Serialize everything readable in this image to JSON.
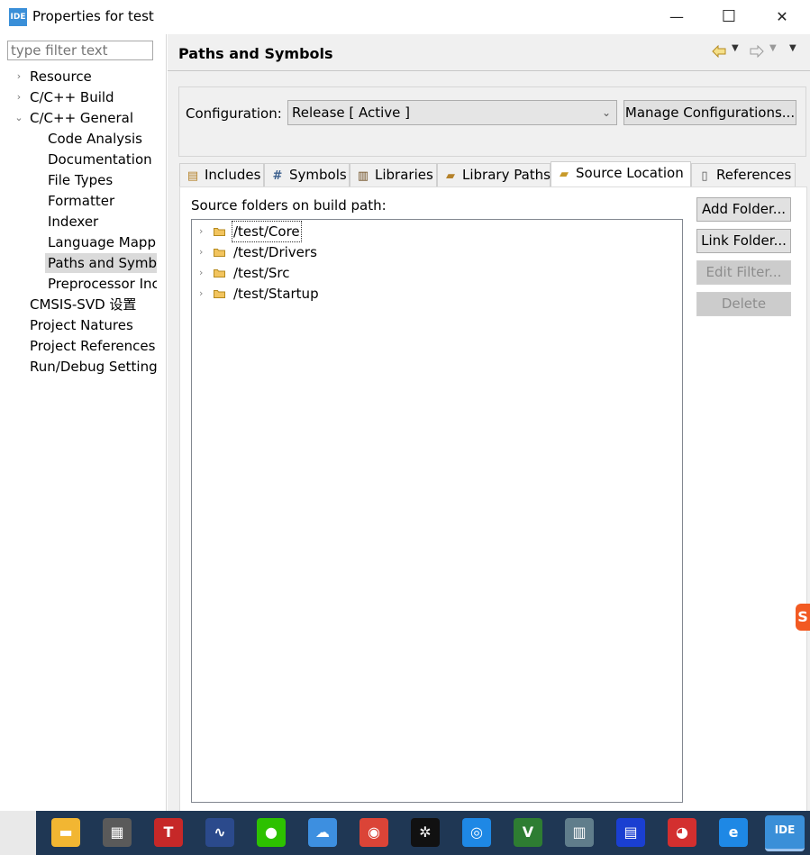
{
  "window": {
    "title": "Properties for test",
    "app_icon": "IDE",
    "minimize_glyph": "—",
    "maximize_glyph": "☐",
    "close_glyph": "✕"
  },
  "sidebar": {
    "filter_placeholder": "type filter text",
    "items": [
      {
        "label": "Resource",
        "level": 0,
        "expander": "collapsed"
      },
      {
        "label": "C/C++ Build",
        "level": 0,
        "expander": "collapsed"
      },
      {
        "label": "C/C++ General",
        "level": 0,
        "expander": "expanded"
      },
      {
        "label": "Code Analysis",
        "level": 1,
        "expander": "collapsed"
      },
      {
        "label": "Documentation",
        "level": 1,
        "expander": "none"
      },
      {
        "label": "File Types",
        "level": 1,
        "expander": "none"
      },
      {
        "label": "Formatter",
        "level": 1,
        "expander": "none"
      },
      {
        "label": "Indexer",
        "level": 1,
        "expander": "none"
      },
      {
        "label": "Language Mappi",
        "level": 1,
        "expander": "none"
      },
      {
        "label": "Paths and Symbo",
        "level": 1,
        "expander": "none",
        "selected": true
      },
      {
        "label": "Preprocessor Inc",
        "level": 1,
        "expander": "none"
      },
      {
        "label": "CMSIS-SVD 设置",
        "level": 0,
        "expander": "none"
      },
      {
        "label": "Project Natures",
        "level": 0,
        "expander": "none"
      },
      {
        "label": "Project References",
        "level": 0,
        "expander": "none"
      },
      {
        "label": "Run/Debug Setting",
        "level": 0,
        "expander": "none"
      }
    ]
  },
  "header": {
    "title": "Paths and Symbols",
    "back_icon": "back-arrow-icon",
    "forward_icon": "forward-arrow-icon"
  },
  "configuration": {
    "label": "Configuration:",
    "selected": "Release  [ Active ]",
    "manage_button": "Manage Configurations..."
  },
  "tabs": [
    {
      "label": "Includes",
      "icon": "includes-icon",
      "active": false
    },
    {
      "label": "Symbols",
      "icon": "hash-icon",
      "active": false
    },
    {
      "label": "Libraries",
      "icon": "libraries-icon",
      "active": false
    },
    {
      "label": "Library Paths",
      "icon": "library-paths-icon",
      "active": false
    },
    {
      "label": "Source Location",
      "icon": "folder-open-icon",
      "active": true
    },
    {
      "label": "References",
      "icon": "references-icon",
      "active": false
    }
  ],
  "source_location": {
    "label": "Source folders on build path:",
    "folders": [
      "/test/Core",
      "/test/Drivers",
      "/test/Src",
      "/test/Startup"
    ],
    "buttons": {
      "add_folder": "Add Folder...",
      "link_folder": "Link Folder...",
      "edit_filter": "Edit Filter...",
      "delete": "Delete"
    }
  },
  "taskbar": {
    "apps": [
      {
        "name": "file-explorer",
        "glyph": "▬",
        "color": "#f2b632"
      },
      {
        "name": "calculator",
        "glyph": "▦",
        "color": "#5a5a5a"
      },
      {
        "name": "tiktok-toolbox",
        "glyph": "T",
        "color": "#c62828"
      },
      {
        "name": "graph-app",
        "glyph": "∿",
        "color": "#2b4a8c"
      },
      {
        "name": "wechat",
        "glyph": "●",
        "color": "#2dc100"
      },
      {
        "name": "cloud-drive",
        "glyph": "☁",
        "color": "#3d8fe0"
      },
      {
        "name": "chrome",
        "glyph": "◉",
        "color": "#db4437"
      },
      {
        "name": "atom-app",
        "glyph": "✲",
        "color": "#111111"
      },
      {
        "name": "spiral-app",
        "glyph": "◎",
        "color": "#1e88e5"
      },
      {
        "name": "keil-v5",
        "glyph": "V",
        "color": "#2e7d32"
      },
      {
        "name": "building-app",
        "glyph": "▥",
        "color": "#607d8b"
      },
      {
        "name": "grid-building-app",
        "glyph": "▤",
        "color": "#1a3fd1"
      },
      {
        "name": "pig-app",
        "glyph": "◕",
        "color": "#d32f2f"
      },
      {
        "name": "edge-browser",
        "glyph": "e",
        "color": "#1e88e5"
      },
      {
        "name": "stm32cubeide",
        "glyph": "IDE",
        "color": "#3a8fd8",
        "active": true
      }
    ]
  }
}
